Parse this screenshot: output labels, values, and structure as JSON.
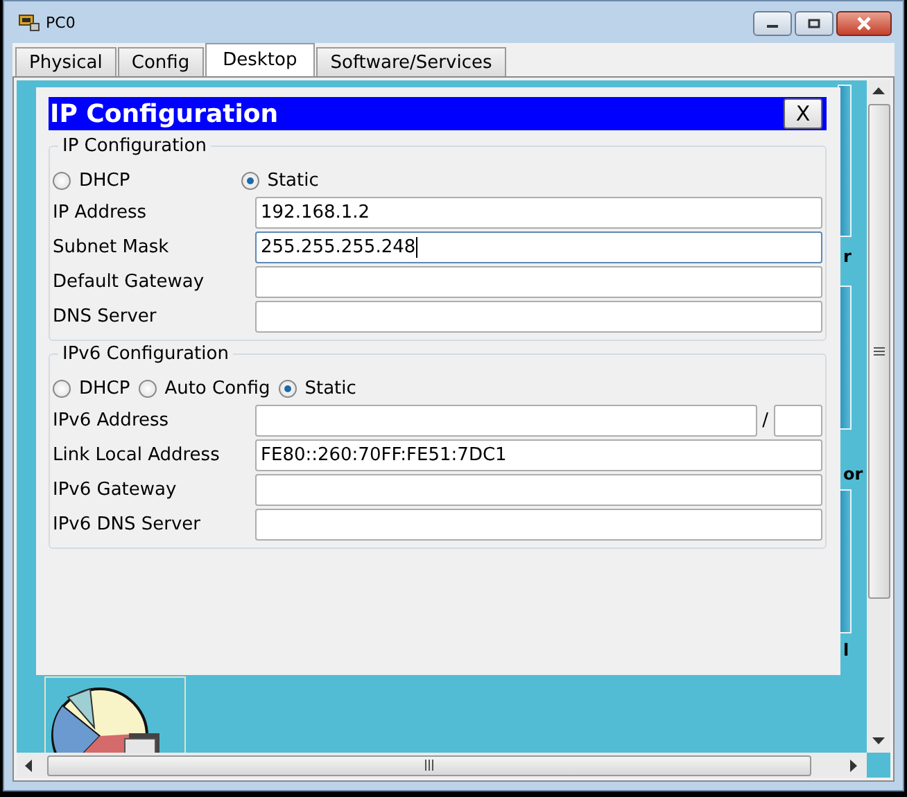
{
  "window": {
    "title": "PC0"
  },
  "tabs": [
    {
      "label": "Physical",
      "selected": false
    },
    {
      "label": "Config",
      "selected": false
    },
    {
      "label": "Desktop",
      "selected": true
    },
    {
      "label": "Software/Services",
      "selected": false
    }
  ],
  "background_fragments": [
    "r",
    "or",
    "l"
  ],
  "dialog": {
    "title": "IP Configuration",
    "close_label": "X",
    "ipv4": {
      "legend": "IP Configuration",
      "modes": [
        {
          "label": "DHCP",
          "selected": false
        },
        {
          "label": "Static",
          "selected": true
        }
      ],
      "fields": [
        {
          "kind": "plain",
          "label": "IP Address",
          "value": "192.168.1.2",
          "focused": false
        },
        {
          "kind": "plain",
          "label": "Subnet Mask",
          "value": "255.255.255.248",
          "focused": true
        },
        {
          "kind": "plain",
          "label": "Default Gateway",
          "focused": false
        },
        {
          "kind": "plain",
          "label": "DNS Server",
          "focused": false
        }
      ]
    },
    "ipv6": {
      "legend": "IPv6 Configuration",
      "modes": [
        {
          "label": "DHCP",
          "selected": false
        },
        {
          "label": "Auto Config",
          "selected": false
        },
        {
          "label": "Static",
          "selected": true
        }
      ],
      "fields": [
        {
          "kind": "prefixed",
          "label": "IPv6 Address",
          "separator": "/",
          "focused": false
        },
        {
          "kind": "plain",
          "label": "Link Local Address",
          "value": "FE80::260:70FF:FE51:7DC1",
          "focused": false
        },
        {
          "kind": "plain",
          "label": "IPv6 Gateway",
          "focused": false
        },
        {
          "kind": "plain",
          "label": "IPv6 DNS Server",
          "focused": false
        }
      ]
    }
  }
}
